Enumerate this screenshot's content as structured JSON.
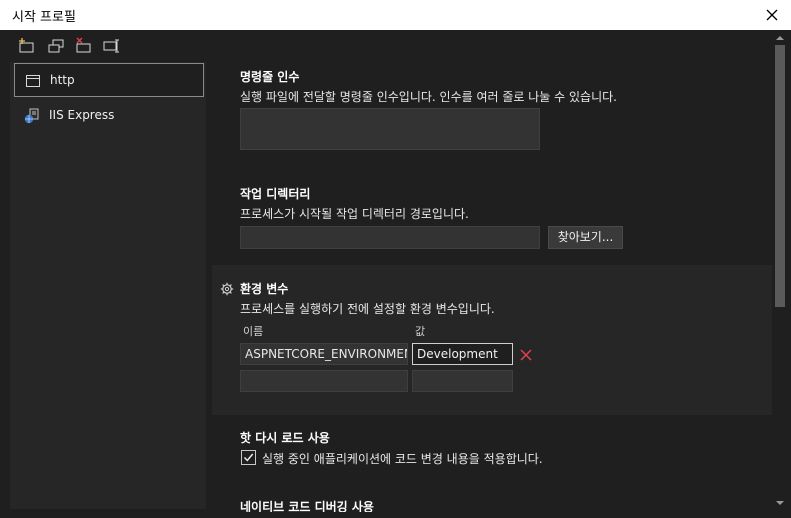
{
  "window": {
    "title": "시작 프로필"
  },
  "toolbar": {
    "icons": [
      "new-profile-icon",
      "copy-profile-icon",
      "delete-profile-icon",
      "rename-profile-icon"
    ]
  },
  "profiles": [
    {
      "label": "http",
      "icon": "window-icon",
      "selected": true
    },
    {
      "label": "IIS Express",
      "icon": "iis-express-icon",
      "selected": false
    }
  ],
  "sections": {
    "args": {
      "title": "명령줄 인수",
      "description": "실행 파일에 전달할 명령줄 인수입니다. 인수를 여러 줄로 나눌 수 있습니다.",
      "value": ""
    },
    "workdir": {
      "title": "작업 디렉터리",
      "description": "프로세스가 시작될 작업 디렉터리 경로입니다.",
      "value": "",
      "browse_label": "찾아보기..."
    },
    "env": {
      "title": "환경 변수",
      "description": "프로세스를 실행하기 전에 설정할 환경 변수입니다.",
      "name_header": "이름",
      "value_header": "값",
      "rows": [
        {
          "name": "ASPNETCORE_ENVIRONMENT",
          "value": "Development"
        }
      ]
    },
    "hotreload": {
      "title": "핫 다시 로드 사용",
      "checkbox_label": "실행 중인 애플리케이션에 코드 변경 내용을 적용합니다.",
      "checked": true
    },
    "native": {
      "title": "네이티브 코드 디버깅 사용"
    }
  },
  "colors": {
    "delete": "#e04050",
    "background": "#1f1f1f",
    "panel": "#262626"
  }
}
